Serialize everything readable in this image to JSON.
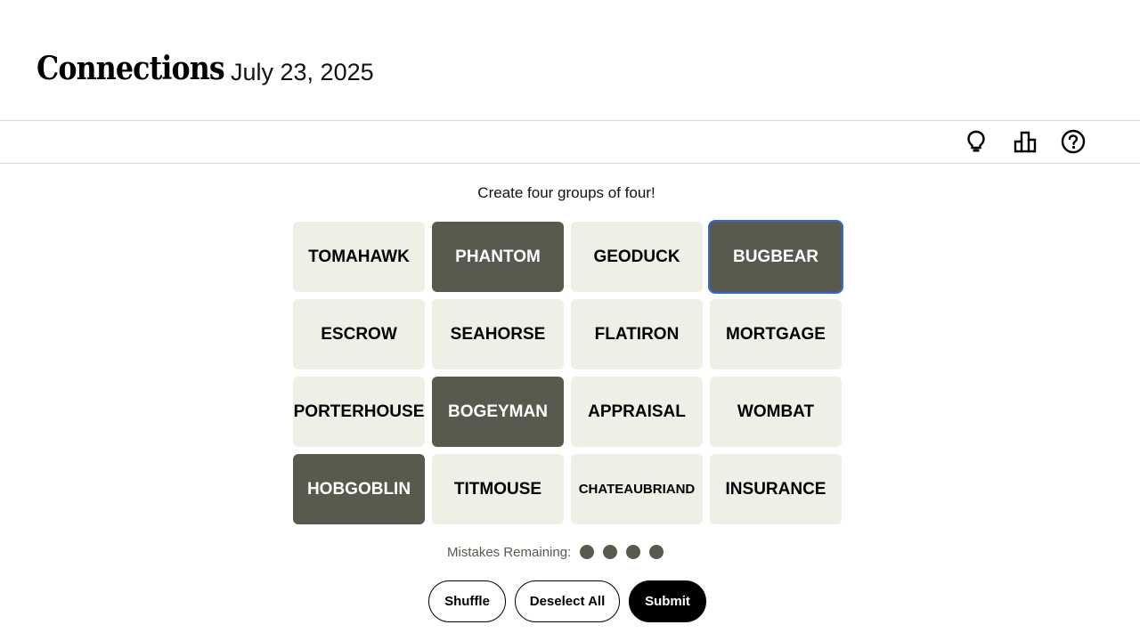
{
  "header": {
    "title": "Connections",
    "date": "July 23, 2025"
  },
  "toolbar": {
    "icons": [
      "lightbulb-icon",
      "leaderboard-icon",
      "help-icon"
    ]
  },
  "game": {
    "instructions": "Create four groups of four!",
    "tiles": [
      {
        "word": "TOMAHAWK",
        "selected": false
      },
      {
        "word": "PHANTOM",
        "selected": true
      },
      {
        "word": "GEODUCK",
        "selected": false
      },
      {
        "word": "BUGBEAR",
        "selected": true
      },
      {
        "word": "ESCROW",
        "selected": false
      },
      {
        "word": "SEAHORSE",
        "selected": false
      },
      {
        "word": "FLATIRON",
        "selected": false
      },
      {
        "word": "MORTGAGE",
        "selected": false
      },
      {
        "word": "PORTERHOUSE",
        "selected": false
      },
      {
        "word": "BOGEYMAN",
        "selected": true
      },
      {
        "word": "APPRAISAL",
        "selected": false
      },
      {
        "word": "WOMBAT",
        "selected": false
      },
      {
        "word": "HOBGOBLIN",
        "selected": true
      },
      {
        "word": "TITMOUSE",
        "selected": false
      },
      {
        "word": "CHATEAUBRIAND",
        "selected": false
      },
      {
        "word": "INSURANCE",
        "selected": false
      }
    ],
    "mistakes_label": "Mistakes Remaining:",
    "mistakes_remaining": 4
  },
  "colors": {
    "selected_tile": "#5a594e",
    "unselected_tile": "#efefe6",
    "focus_outline": "#2b6cd6"
  },
  "buttons": {
    "shuffle": "Shuffle",
    "deselect_all": "Deselect All",
    "submit": "Submit"
  }
}
